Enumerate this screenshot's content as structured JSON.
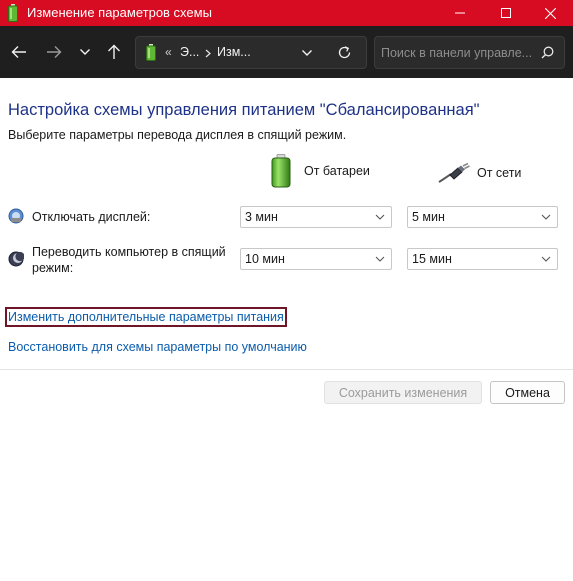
{
  "window": {
    "title": "Изменение параметров схемы"
  },
  "navbar": {
    "breadcrumb": [
      "«",
      "Э...",
      "Изм..."
    ],
    "search_placeholder": "Поиск в панели управле..."
  },
  "main": {
    "heading": "Настройка схемы управления питанием \"Сбалансированная\"",
    "subtitle": "Выберите параметры перевода дисплея в спящий режим.",
    "columns": {
      "battery": "От батареи",
      "plugged": "От сети"
    },
    "rows": [
      {
        "label": "Отключать дисплей:",
        "battery_value": "3 мин",
        "plugged_value": "5 мин"
      },
      {
        "label_line1": "Переводить компьютер в спящий",
        "label_line2": "режим:",
        "battery_value": "10 мин",
        "plugged_value": "15 мин"
      }
    ],
    "links": {
      "advanced": "Изменить дополнительные параметры питания",
      "restore": "Восстановить для схемы параметры по умолчанию"
    },
    "buttons": {
      "save": "Сохранить изменения",
      "cancel": "Отмена"
    }
  },
  "colors": {
    "titlebar": "#d70b21",
    "navbar": "#1f1f1f",
    "heading": "#1e3287",
    "link": "#0b5cad",
    "focus_border": "#6e1628"
  }
}
